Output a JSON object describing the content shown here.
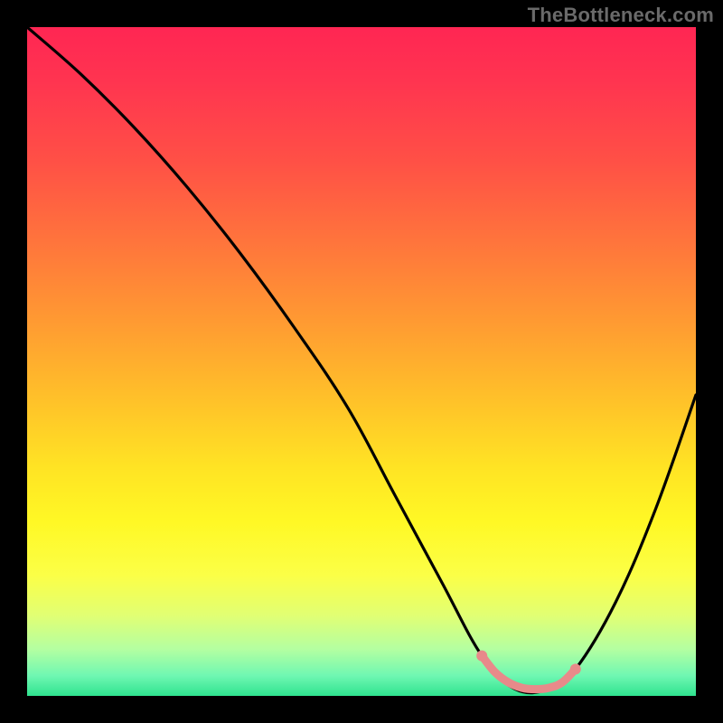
{
  "watermark": "TheBottleneck.com",
  "chart_data": {
    "type": "line",
    "title": "",
    "xlabel": "",
    "ylabel": "",
    "xlim": [
      0,
      100
    ],
    "ylim": [
      0,
      100
    ],
    "grid": false,
    "series": [
      {
        "name": "v-curve",
        "x": [
          0,
          8,
          16,
          24,
          32,
          40,
          48,
          55,
          62,
          68,
          73,
          78,
          82,
          88,
          94,
          100
        ],
        "y": [
          100,
          93,
          85,
          76,
          66,
          55,
          43,
          30,
          17,
          6,
          1,
          1,
          4,
          14,
          28,
          45
        ]
      },
      {
        "name": "flat-highlight",
        "x": [
          68,
          70,
          72,
          74,
          76,
          78,
          80,
          82
        ],
        "y": [
          6,
          3.5,
          2,
          1.2,
          1,
          1.2,
          2,
          4
        ]
      }
    ],
    "gradient_stops": [
      {
        "pos": 0,
        "color": "#ff2653"
      },
      {
        "pos": 20,
        "color": "#ff5046"
      },
      {
        "pos": 44,
        "color": "#ff9a32"
      },
      {
        "pos": 66,
        "color": "#ffe424"
      },
      {
        "pos": 88,
        "color": "#e1ff74"
      },
      {
        "pos": 100,
        "color": "#2fe38f"
      }
    ],
    "pink_color": "#e88a8a"
  }
}
